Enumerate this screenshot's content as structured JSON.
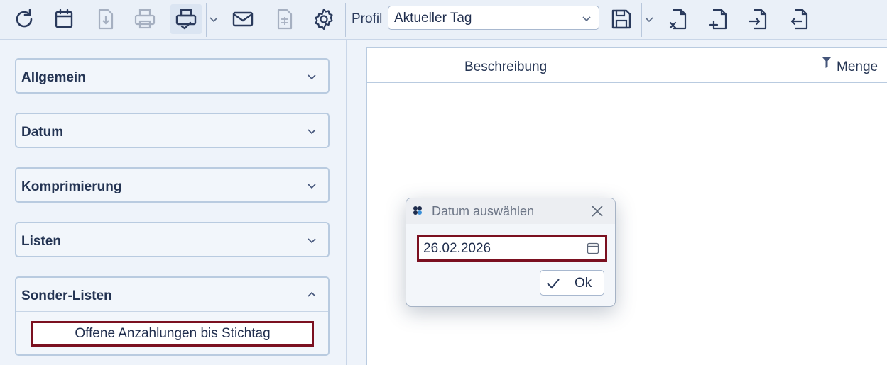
{
  "toolbar": {
    "buttons": [
      {
        "icon": "refresh-icon",
        "enabled": true
      },
      {
        "icon": "calendar-icon",
        "enabled": true
      },
      {
        "icon": "download-doc-icon",
        "enabled": false
      },
      {
        "icon": "print-icon",
        "enabled": false
      },
      {
        "icon": "print-preview-icon",
        "enabled": true
      },
      {
        "icon": "mail-icon",
        "enabled": true
      },
      {
        "icon": "spreadsheet-doc-icon",
        "enabled": false
      },
      {
        "icon": "gear-icon",
        "enabled": true
      },
      {
        "icon": "save-icon",
        "enabled": true
      },
      {
        "icon": "doc-delete-icon",
        "enabled": true
      },
      {
        "icon": "doc-add-icon",
        "enabled": true
      },
      {
        "icon": "doc-import-icon",
        "enabled": true
      },
      {
        "icon": "doc-export-icon",
        "enabled": true
      }
    ],
    "profil_label": "Profil",
    "profil_value": "Aktueller Tag"
  },
  "sidebar": {
    "sections": [
      {
        "label": "Allgemein",
        "expanded": false
      },
      {
        "label": "Datum",
        "expanded": false
      },
      {
        "label": "Komprimierung",
        "expanded": false
      },
      {
        "label": "Listen",
        "expanded": false
      },
      {
        "label": "Sonder-Listen",
        "expanded": true,
        "items": [
          "Offene Anzahlungen bis Stichtag"
        ]
      }
    ]
  },
  "grid": {
    "columns": [
      "",
      "Beschreibung",
      "Menge"
    ]
  },
  "dialog": {
    "title": "Datum auswählen",
    "date_value": "26.02.2026",
    "ok_label": "Ok"
  },
  "colors": {
    "accent_border": "#7b1020",
    "icon_color": "#2a3a5c",
    "panel_background": "#eef3fa"
  }
}
